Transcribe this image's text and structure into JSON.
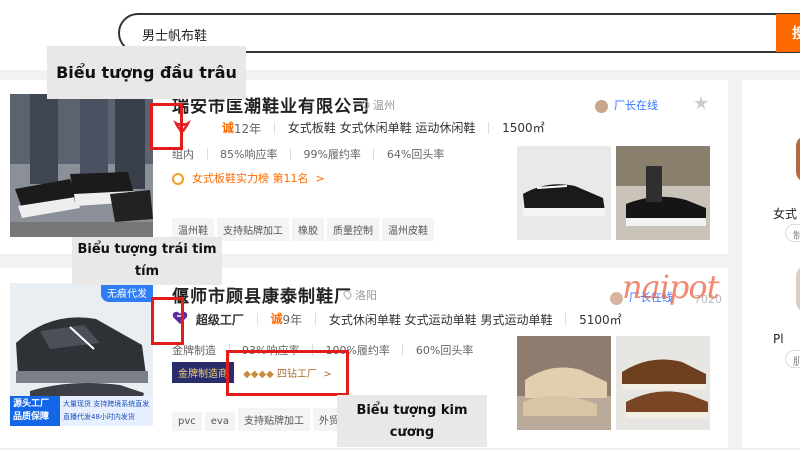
{
  "search": {
    "query": "男士帆布鞋",
    "button_label": "搜"
  },
  "listings": [
    {
      "company": "瑞安市匡潮鞋业有限公司",
      "location": "温州",
      "years": "12年",
      "categories": "女式板鞋 女式休闲单鞋 运动休闲鞋",
      "area": "1500㎡",
      "rates": [
        "85%响应率",
        "99%履约率",
        "64%回头率"
      ],
      "rates_prefix": "组内",
      "rank": "女式板鞋实力榜 第11名",
      "tags": [
        "温州鞋",
        "支持贴牌加工",
        "橡胶",
        "质量控制",
        "温州皮鞋"
      ],
      "chat": "厂长在线"
    },
    {
      "company": "偃师市顾县康泰制鞋厂",
      "location": "洛阳",
      "tier": "超级工厂",
      "years": "9年",
      "categories": "女式休闲单鞋 女式运动单鞋 男式运动单鞋",
      "area": "5100㎡",
      "rates": [
        "93%响应率",
        "100%履约率",
        "60%回头率"
      ],
      "rates_prefix": "金牌制造",
      "brand_badge": "金牌制造商",
      "diamond_level": "四钻工厂",
      "tags": [
        "pvc",
        "eva",
        "支持贴牌加工",
        "外贸"
      ],
      "chat": "厂长在线",
      "count": "7020",
      "image_badge": "无痕代发",
      "image_banner_left": "源头工厂\n品质保障",
      "image_banner_right": "大量现货 支持跨境系统直发\n直播代发48小时内发货"
    }
  ],
  "sidebar": {
    "item1": "女式",
    "item1_pill": "制",
    "item2": "Pl",
    "item2_pill": "肌"
  },
  "watermark": "naipot",
  "annotations": {
    "bull_icon": "Biểu tượng đầu trâu",
    "heart_icon": "Biểu tượng trái tim tím",
    "diamond_icon": "Biểu tượng kim cương"
  },
  "colors": {
    "accent": "#ff6a00",
    "annotation_border": "#e21b1b",
    "brand_badge": "#2a2d6b"
  }
}
